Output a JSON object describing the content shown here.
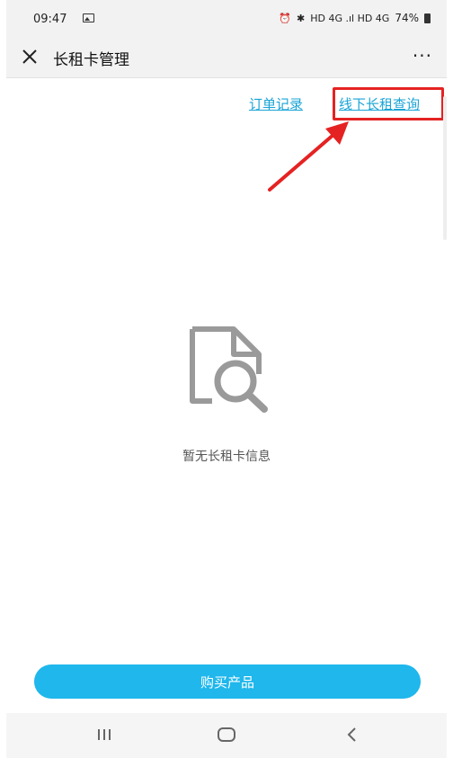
{
  "status_bar": {
    "time": "09:47",
    "indicators": "HD 4G .ıl HD 4G",
    "battery": "74%"
  },
  "nav": {
    "title": "长租卡管理",
    "more": "···"
  },
  "links": {
    "orders": "订单记录",
    "offline": "线下长租查询"
  },
  "empty_state": {
    "message": "暂无长租卡信息",
    "icon": "document-search-icon"
  },
  "buy_button": {
    "label": "购买产品"
  },
  "colors": {
    "accent": "#1fb7ec",
    "link": "#1aa4d6",
    "annotation": "#e52222"
  }
}
